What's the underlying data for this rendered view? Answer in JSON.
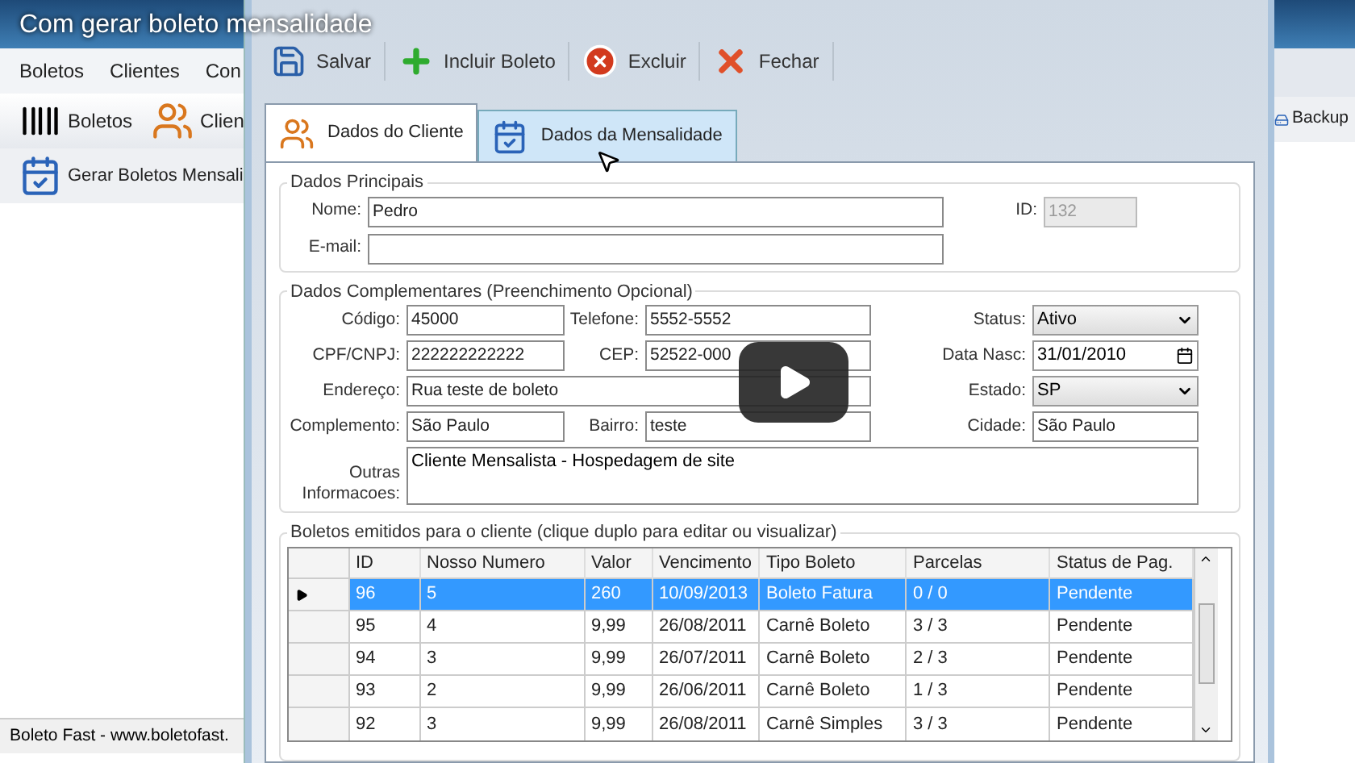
{
  "video": {
    "title": "Com gerar boleto mensalidade"
  },
  "main_window": {
    "menu": [
      "Boletos",
      "Clientes",
      "Con"
    ],
    "toolbar": [
      {
        "label": "Boletos",
        "kind": "barcode"
      },
      {
        "label": "Clien",
        "kind": "users"
      }
    ],
    "toolbar_row2": [
      {
        "label": "Gerar Boletos Mensali",
        "kind": "calendar"
      }
    ],
    "status_bar": "Boleto Fast - www.boletofast.",
    "right_toolbar": [
      {
        "label": "Backup",
        "kind": "backup"
      }
    ]
  },
  "dialog": {
    "toolbar": [
      {
        "label": "Salvar",
        "kind": "save"
      },
      {
        "label": "Incluir Boleto",
        "kind": "add"
      },
      {
        "label": "Excluir",
        "kind": "delete"
      },
      {
        "label": "Fechar",
        "kind": "close"
      }
    ],
    "tabs": [
      {
        "label": "Dados do Cliente",
        "kind": "users",
        "selected": true
      },
      {
        "label": "Dados da Mensalidade",
        "kind": "calendar",
        "selected": false
      }
    ],
    "dados_principais": {
      "title": "Dados Principais",
      "nome": {
        "label": "Nome:",
        "value": "Pedro"
      },
      "email": {
        "label": "E-mail:"
      },
      "id": {
        "label": "ID:",
        "value": "132",
        "disabled": true
      }
    },
    "dados_complementares": {
      "title": "Dados Complementares (Preenchimento Opcional)",
      "codigo": {
        "label": "Código:",
        "value": "45000"
      },
      "telefone": {
        "label": "Telefone:",
        "value": "5552-5552"
      },
      "status": {
        "label": "Status:",
        "value": "Ativo"
      },
      "cpf": {
        "label": "CPF/CNPJ:",
        "value": "222222222222"
      },
      "cep": {
        "label": "CEP:",
        "value": "52522-000"
      },
      "data_nasc": {
        "label": "Data Nasc:",
        "value": "31/01/2010"
      },
      "endereco": {
        "label": "Endereço:",
        "value": "Rua teste de boleto"
      },
      "estado": {
        "label": "Estado:",
        "value": "SP"
      },
      "complemento": {
        "label": "Complemento:",
        "value": "São Paulo"
      },
      "bairro": {
        "label": "Bairro:",
        "value": "teste"
      },
      "cidade": {
        "label": "Cidade:",
        "value": "São Paulo"
      },
      "outras": {
        "label": "Outras Informacoes:",
        "value": "Cliente Mensalista - Hospedagem de site"
      }
    },
    "boletos": {
      "title": "Boletos emitidos para o cliente (clique duplo para editar ou visualizar)",
      "columns": [
        "ID",
        "Nosso Numero",
        "Valor",
        "Vencimento",
        "Tipo Boleto",
        "Parcelas",
        "Status de Pag."
      ],
      "rows": [
        {
          "cells": [
            "96",
            "5",
            "260",
            "10/09/2013",
            "Boleto Fatura",
            "0 / 0",
            "Pendente"
          ],
          "selected": true
        },
        {
          "cells": [
            "95",
            "4",
            "9,99",
            "26/08/2011",
            "Carnê Boleto",
            "3 / 3",
            "Pendente"
          ],
          "selected": false
        },
        {
          "cells": [
            "94",
            "3",
            "9,99",
            "26/07/2011",
            "Carnê Boleto",
            "2 / 3",
            "Pendente"
          ],
          "selected": false
        },
        {
          "cells": [
            "93",
            "2",
            "9,99",
            "26/06/2011",
            "Carnê Boleto",
            "1 / 3",
            "Pendente"
          ],
          "selected": false
        },
        {
          "cells": [
            "92",
            "3",
            "9,99",
            "26/08/2011",
            "Carnê Simples",
            "3 / 3",
            "Pendente"
          ],
          "selected": false
        }
      ]
    }
  }
}
